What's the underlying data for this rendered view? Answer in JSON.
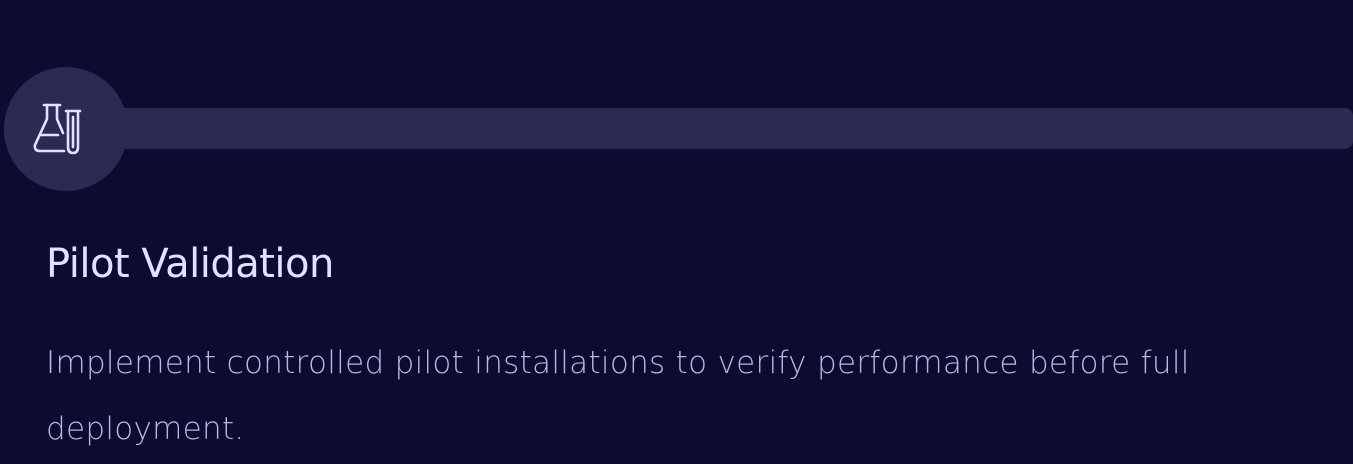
{
  "step": {
    "icon": "flask-icon",
    "title": "Pilot Validation",
    "description": "Implement controlled pilot installations to verify performance before full deployment."
  },
  "colors": {
    "background": "#0d0b30",
    "track": "#2c2a52",
    "icon_stroke": "#e3e1ff",
    "title": "#e3e1ff",
    "description": "#b9b7e6"
  }
}
